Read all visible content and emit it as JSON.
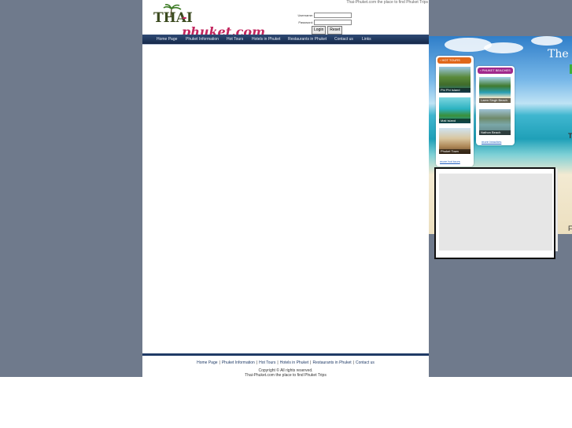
{
  "site": {
    "tagline": "Thai-Phuket.com the place to find Phuket Trips",
    "logo": {
      "part1": "THAI",
      "part2": "-phuket.com"
    }
  },
  "login": {
    "username_label": "Username:",
    "password_label": "Password:",
    "username_value": "",
    "password_value": "",
    "login_button": "Login",
    "reset_button": "Reset"
  },
  "nav": {
    "items": [
      "Home Page",
      "Phuket Information",
      "Hot Tours",
      "Hotels in Phuket",
      "Restaurants in Phuket",
      "Contact us",
      "Links"
    ]
  },
  "footer": {
    "links": [
      "Home Page",
      "Phuket Information",
      "Hot Tours",
      "Hotels in Phuket",
      "Restaurants in Phuket",
      "Contact us"
    ],
    "separator": "|",
    "copyright": "Copyright © All rights reserved.",
    "tagline": "Thai-Phuket.com the place to find Phuket Trips"
  },
  "hero": {
    "headline": "The b",
    "letter_t": "T",
    "letter_f": "F"
  },
  "hot_tours": {
    "title": "› HOT TOURS",
    "items": [
      "Phi Phi Island",
      "Maii Island",
      "Phuket Town"
    ],
    "more": "more hot tours"
  },
  "beaches": {
    "title": "› PHUKET BEACHES",
    "items": [
      "Laem Singh Beach",
      "Nathon Beach"
    ],
    "more": "more beaches"
  },
  "colors": {
    "nav_bg": "#1f3a66",
    "hot_tours_header": "#e0671a",
    "beaches_header": "#a0298c",
    "page_bg": "#6f7a8c"
  }
}
